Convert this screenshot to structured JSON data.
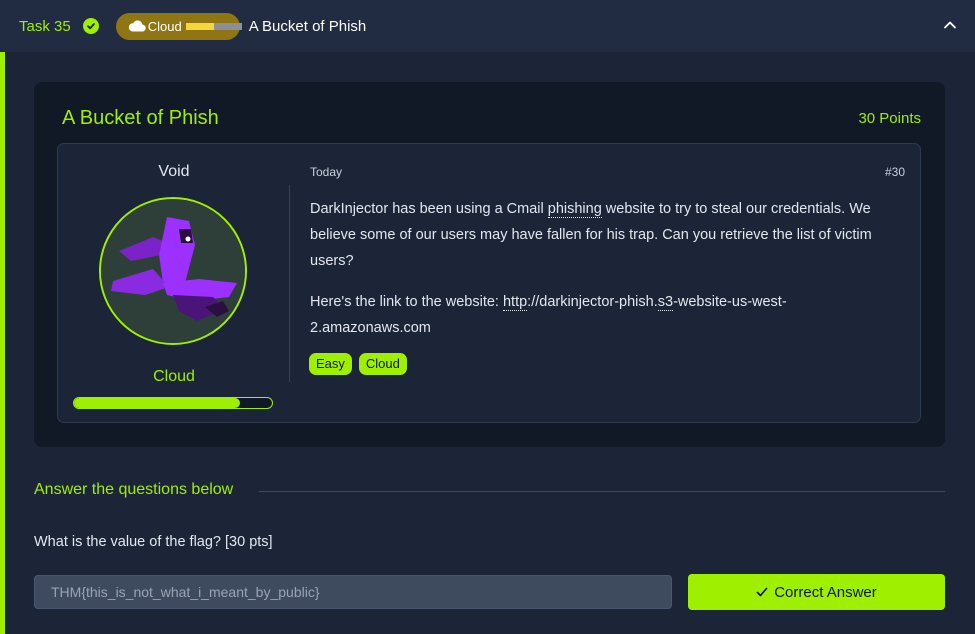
{
  "task": {
    "label": "Task 35",
    "category": "Cloud",
    "title": "A Bucket of Phish",
    "difficulty_colors": [
      "#f5d63d",
      "#f5d63d",
      "#8c8f96",
      "#8c8f96"
    ]
  },
  "room": {
    "title": "A Bucket of Phish",
    "points": "30 Points"
  },
  "author": {
    "name": "Void",
    "rank": "Cloud",
    "progress": 0.84
  },
  "post": {
    "date": "Today",
    "number": "#30",
    "p1_start": "DarkInjector has been using a Cmail ",
    "p1_link": "phishing",
    "p1_end": " website to try to steal our credentials. We believe some of our users may have fallen for his trap. Can you retrieve the list of victim users?",
    "p2_start": "Here's the link to the website: ",
    "p2_url_a": "http",
    "p2_url_b": "://darkinjector-phish.",
    "p2_url_c": "s3",
    "p2_url_d": "-website-us-west-2.amazonaws.com",
    "tags": [
      "Easy",
      "Cloud"
    ]
  },
  "questions": {
    "heading": "Answer the questions below",
    "q1_text": "What is the value of the flag? [30 pts]",
    "q1_answer": "THM{this_is_not_what_i_meant_by_public}",
    "submit_label": "Correct Answer"
  },
  "colors": {
    "accent": "#9fef00",
    "background": "#1c2538",
    "card": "#111927",
    "badge": "#8f7612"
  }
}
